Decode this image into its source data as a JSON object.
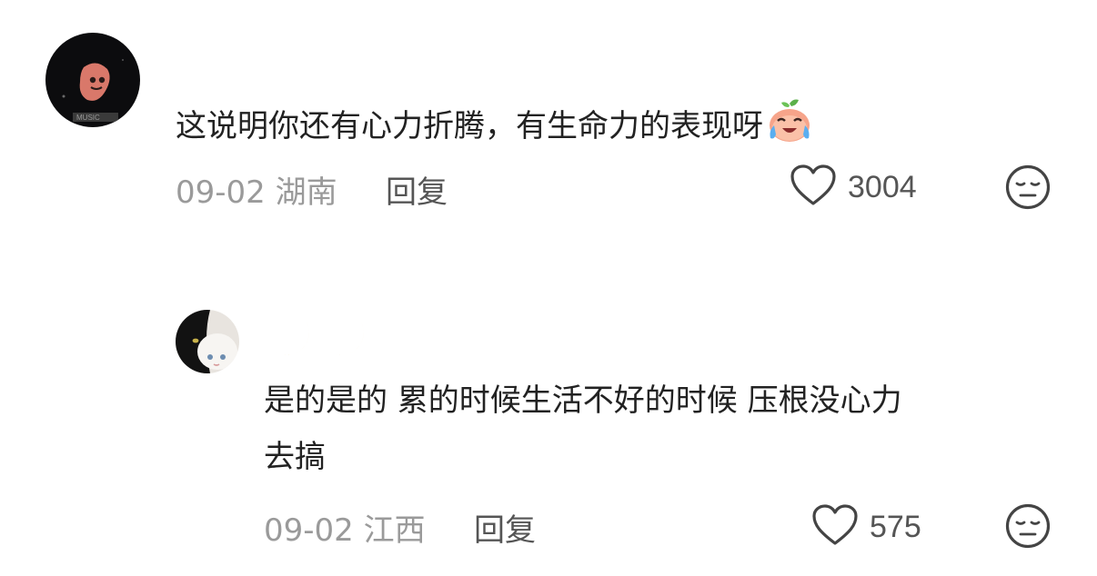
{
  "comments": [
    {
      "text": "这说明你还有心力折腾，有生命力的表现呀",
      "emoji": "crying-laughing-peach-emoji",
      "date": "09-02",
      "location": "湖南",
      "reply_label": "回复",
      "likes": "3004",
      "avatar": "dark-night-avatar"
    },
    {
      "username": "🌙🌙",
      "text_line1": "是的是的 累的时候生活不好的时候 压根没心力",
      "text_line2": "去搞",
      "date": "09-02",
      "location": "江西",
      "reply_label": "回复",
      "likes": "575",
      "avatar": "cat-avatar"
    }
  ]
}
